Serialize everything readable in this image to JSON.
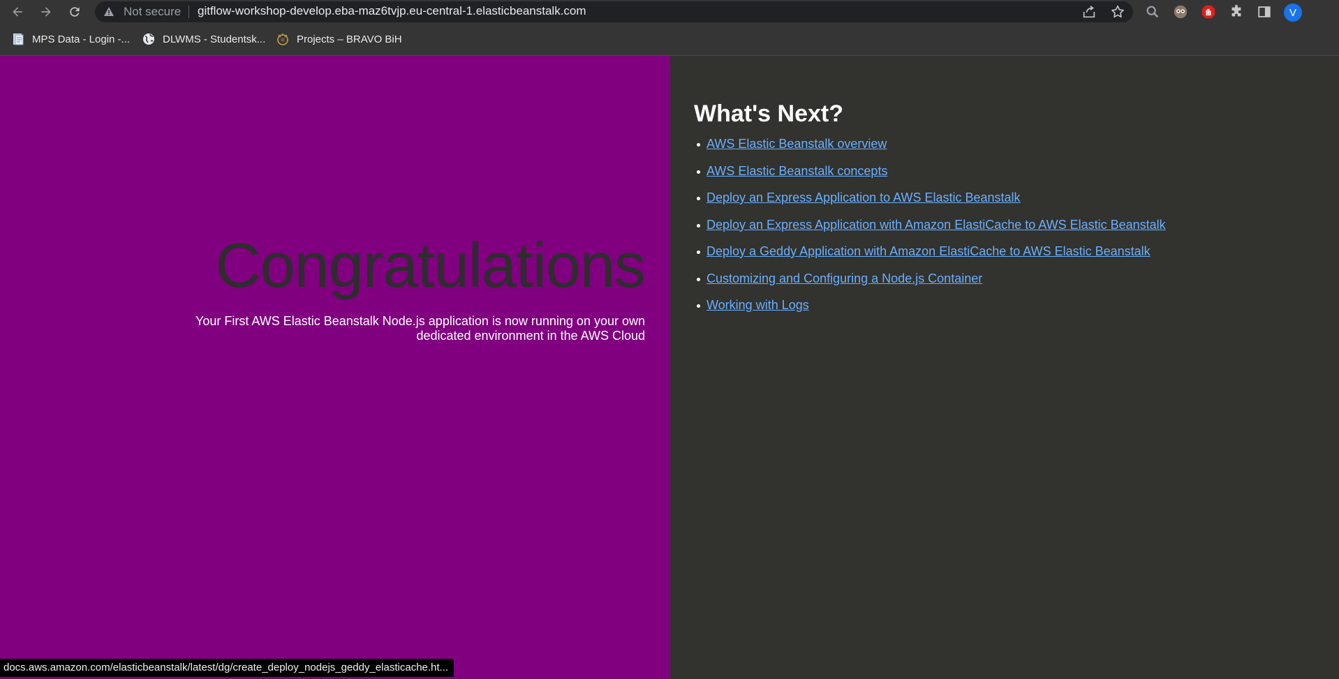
{
  "browser": {
    "security_label": "Not secure",
    "url": "gitflow-workshop-develop.eba-maz6tvjp.eu-central-1.elasticbeanstalk.com",
    "profile_initial": "V",
    "bookmarks": [
      {
        "label": "MPS Data - Login -...",
        "icon": "document-icon"
      },
      {
        "label": "DLWMS - Studentsk...",
        "icon": "globe-icon"
      },
      {
        "label": "Projects – BRAVO BiH",
        "icon": "bravo-logo-icon"
      }
    ]
  },
  "main": {
    "heading": "Congratulations",
    "subtext": "Your First AWS Elastic Beanstalk Node.js application is now running on your own dedicated environment in the AWS Cloud"
  },
  "sidebar": {
    "title": "What's Next?",
    "links": [
      "AWS Elastic Beanstalk overview",
      "AWS Elastic Beanstalk concepts",
      "Deploy an Express Application to AWS Elastic Beanstalk",
      "Deploy an Express Application with Amazon ElastiCache to AWS Elastic Beanstalk",
      "Deploy a Geddy Application with Amazon ElastiCache to AWS Elastic Beanstalk",
      "Customizing and Configuring a Node.js Container",
      "Working with Logs"
    ]
  },
  "status_bar": {
    "url": "docs.aws.amazon.com/elasticbeanstalk/latest/dg/create_deploy_nodejs_geddy_elasticache.ht..."
  },
  "colors": {
    "left_panel": "#800080",
    "right_panel": "#32322e",
    "link": "#6ab0ff",
    "heading_dark": "#2d2d2d"
  }
}
